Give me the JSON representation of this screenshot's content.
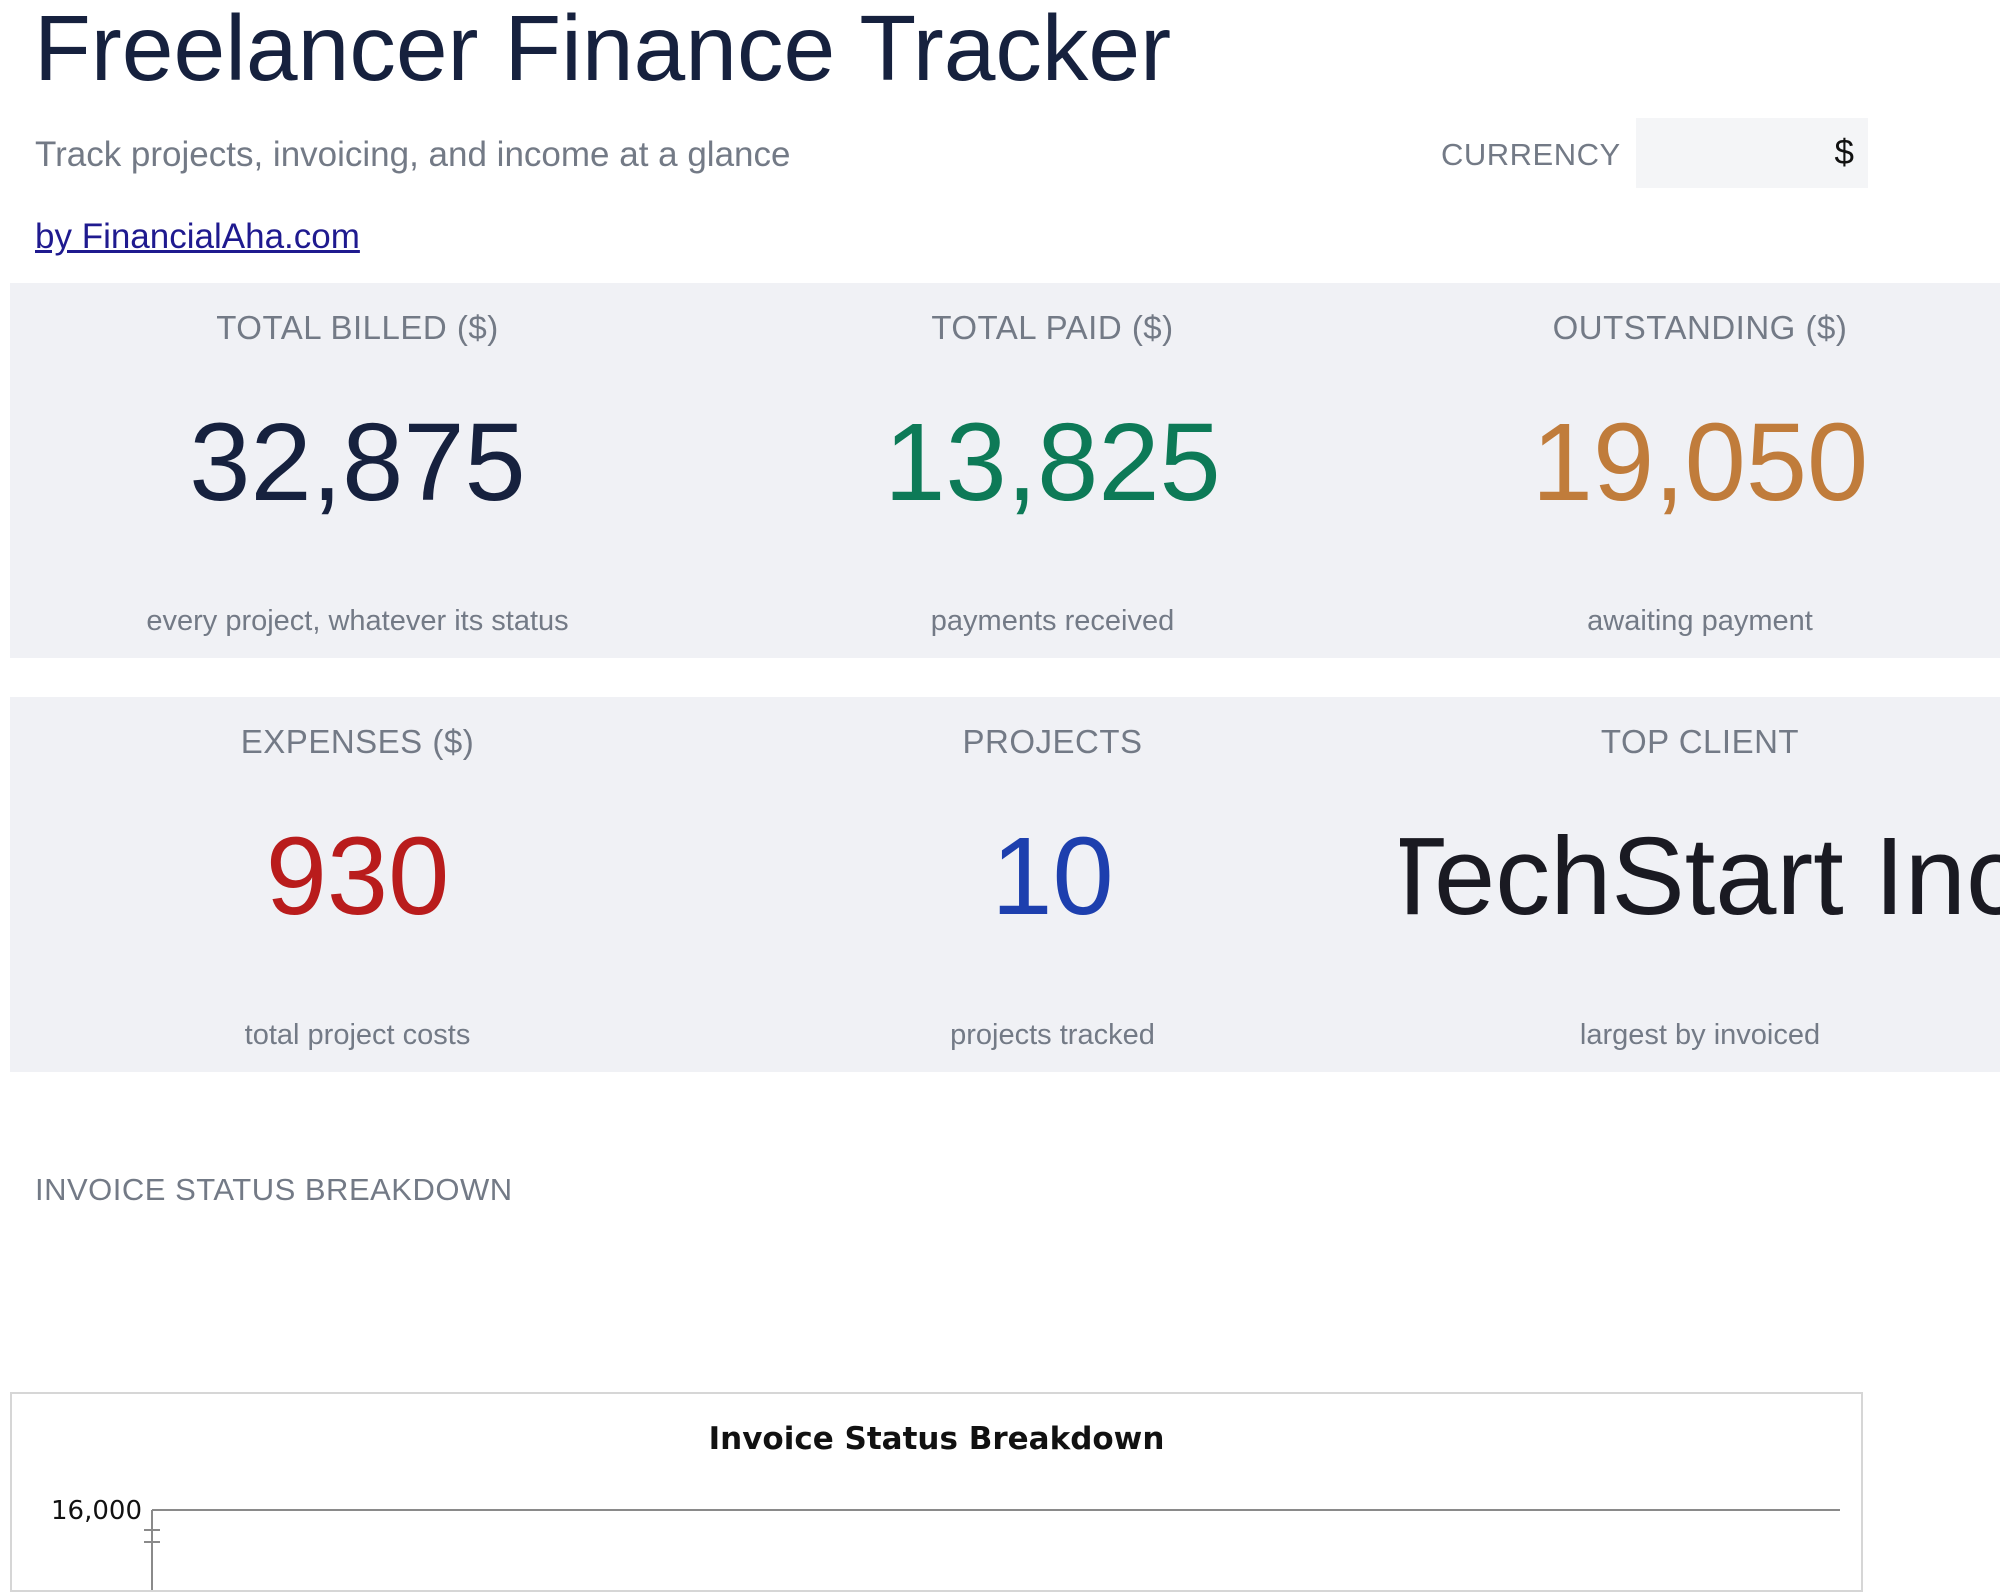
{
  "header": {
    "title": "Freelancer Finance Tracker",
    "subtitle": "Track projects, invoicing, and income at a glance",
    "byline": "by FinancialAha.com",
    "currency_label": "CURRENCY",
    "currency_value": "$"
  },
  "kpis_row1": [
    {
      "label": "TOTAL BILLED ($)",
      "value": "32,875",
      "sub": "every project, whatever its status",
      "color": "#16213e"
    },
    {
      "label": "TOTAL PAID ($)",
      "value": "13,825",
      "sub": "payments received",
      "color": "#0d7a57"
    },
    {
      "label": "OUTSTANDING ($)",
      "value": "19,050",
      "sub": "awaiting payment",
      "color": "#c07c3b"
    }
  ],
  "kpis_row2": [
    {
      "label": "EXPENSES ($)",
      "value": "930",
      "sub": "total project costs",
      "color": "#b91c1c"
    },
    {
      "label": "PROJECTS",
      "value": "10",
      "sub": "projects tracked",
      "color": "#1d3fae"
    },
    {
      "label": "TOP CLIENT",
      "value": "TechStart Inc",
      "sub": "largest by invoiced",
      "color": "#1a1a22"
    }
  ],
  "section": {
    "heading": "INVOICE STATUS BREAKDOWN"
  },
  "chart_data": {
    "type": "bar",
    "title": "Invoice Status Breakdown",
    "y_tick_labels": [
      "16,000"
    ],
    "ylim_max": 16000
  }
}
